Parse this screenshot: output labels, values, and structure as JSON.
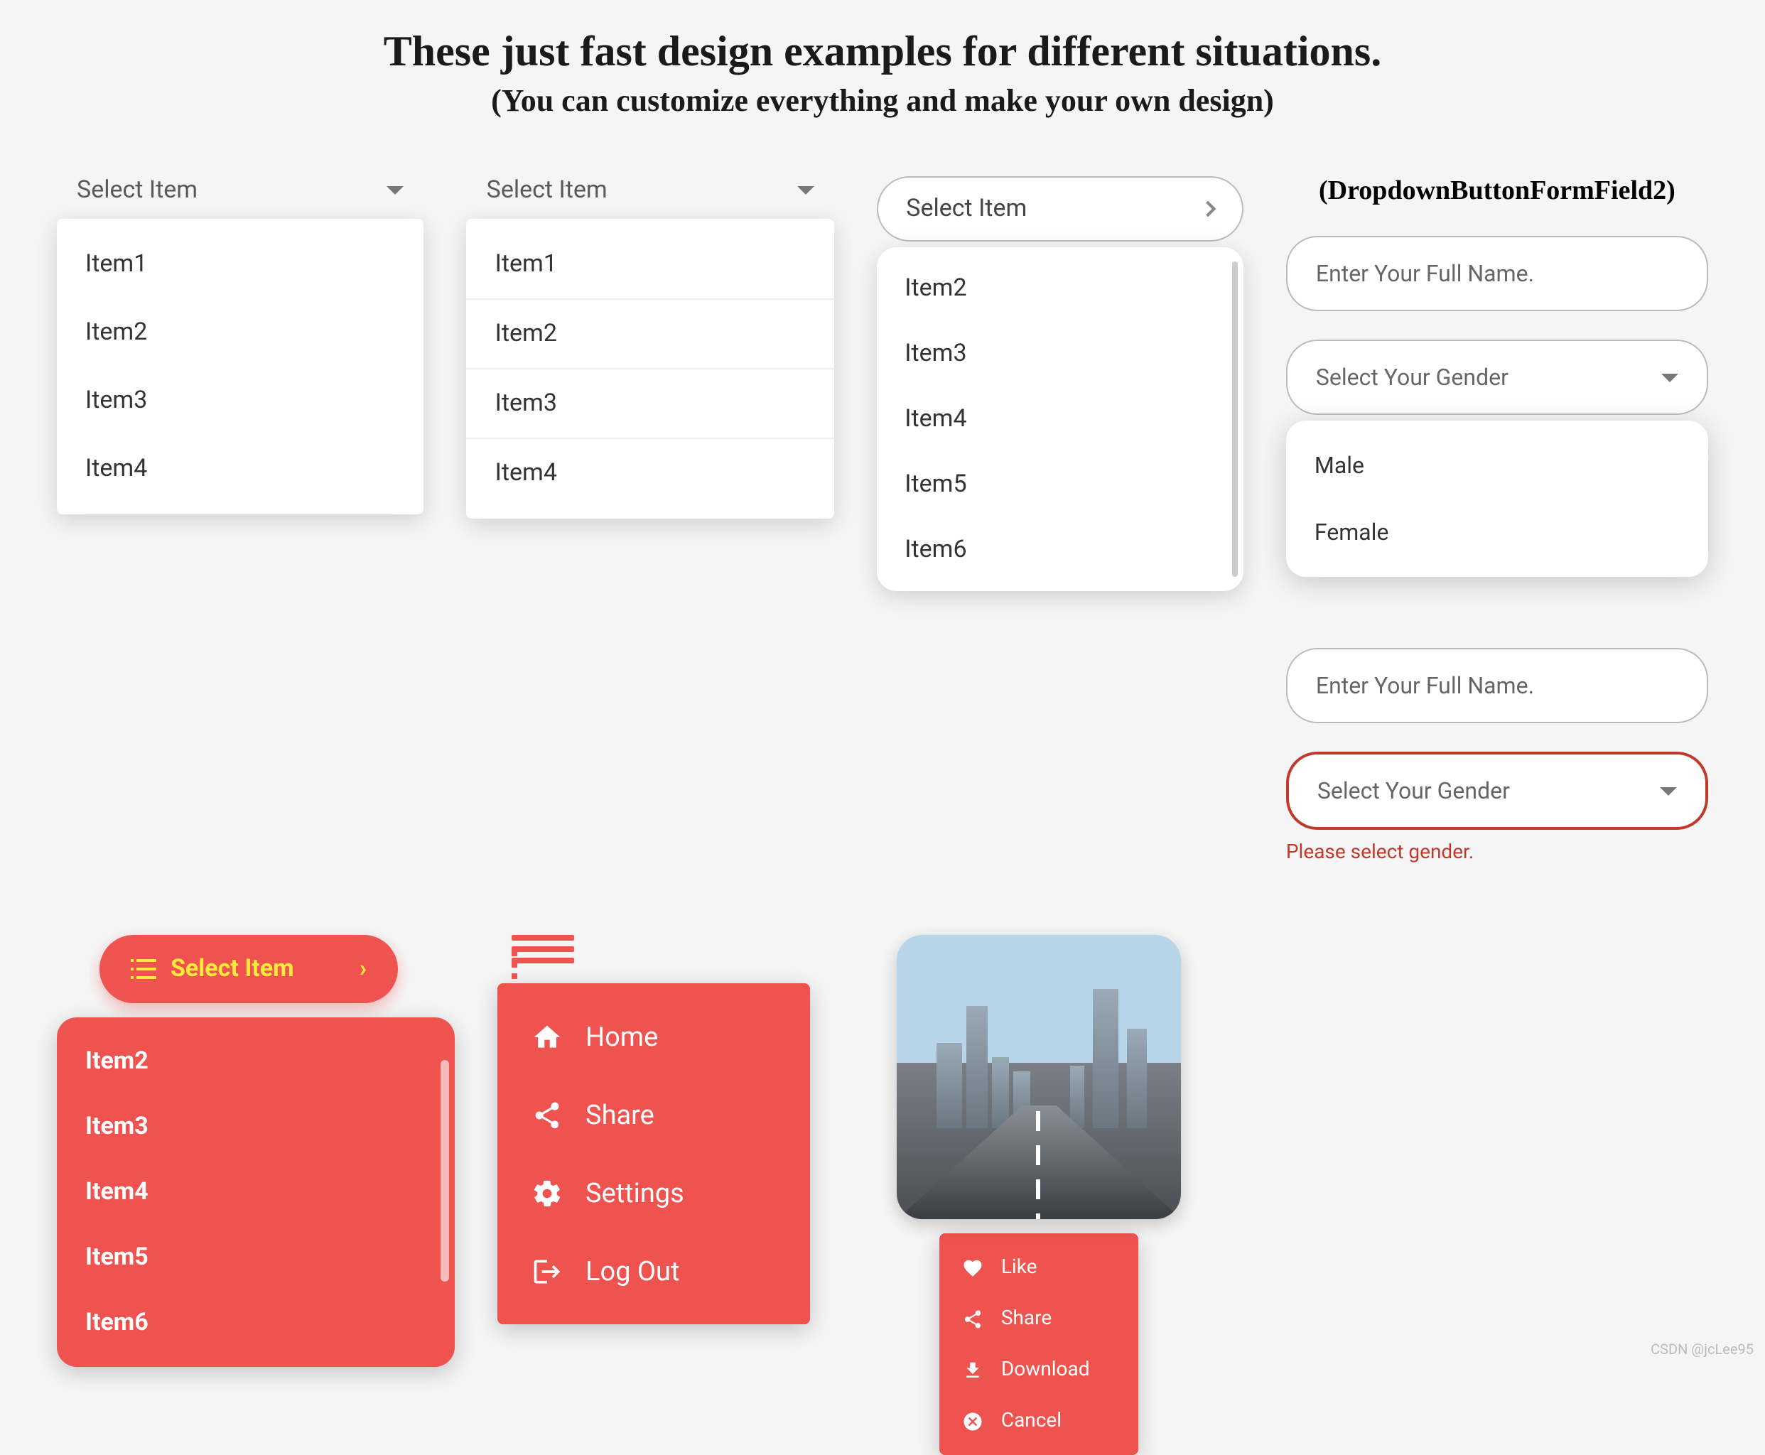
{
  "header": {
    "title": "These just fast design examples for different situations.",
    "subtitle": "(You can customize everything and make your own design)"
  },
  "dropdown1": {
    "label": "Select Item",
    "items": [
      "Item1",
      "Item2",
      "Item3",
      "Item4"
    ]
  },
  "dropdown2": {
    "label": "Select Item",
    "items": [
      "Item1",
      "Item2",
      "Item3",
      "Item4"
    ]
  },
  "dropdown3": {
    "label": "Select Item",
    "items": [
      "Item2",
      "Item3",
      "Item4",
      "Item5",
      "Item6"
    ]
  },
  "formSection": {
    "heading": "(DropdownButtonFormField2)",
    "nameField1": {
      "placeholder": "Enter Your Full Name."
    },
    "genderField1": {
      "label": "Select Your Gender",
      "options": [
        "Male",
        "Female"
      ]
    },
    "nameField2": {
      "placeholder": "Enter Your Full Name."
    },
    "genderField2": {
      "label": "Select Your Gender",
      "error": "Please select gender."
    }
  },
  "redDropdown": {
    "label": "Select Item",
    "items": [
      "Item2",
      "Item3",
      "Item4",
      "Item5",
      "Item6"
    ]
  },
  "menuPanel": {
    "items": [
      {
        "icon": "home",
        "label": "Home"
      },
      {
        "icon": "share",
        "label": "Share"
      },
      {
        "icon": "settings",
        "label": "Settings"
      },
      {
        "icon": "logout",
        "label": "Log Out"
      }
    ]
  },
  "actionPanel": {
    "items": [
      {
        "icon": "heart",
        "label": "Like"
      },
      {
        "icon": "share",
        "label": "Share"
      },
      {
        "icon": "download",
        "label": "Download"
      },
      {
        "icon": "cancel",
        "label": "Cancel"
      }
    ]
  },
  "watermark": "CSDN @jcLee95"
}
